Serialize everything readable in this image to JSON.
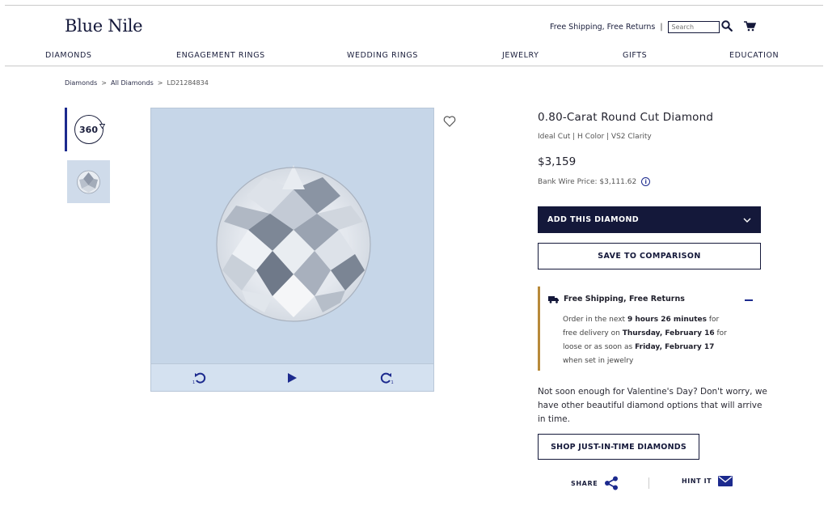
{
  "header": {
    "logo": "Blue Nile",
    "shipping_text": "Free Shipping, Free Returns",
    "separator": "|",
    "search_placeholder": "Search"
  },
  "nav": {
    "items": [
      "DIAMONDS",
      "ENGAGEMENT RINGS",
      "WEDDING RINGS",
      "JEWELRY",
      "GIFTS",
      "EDUCATION"
    ]
  },
  "breadcrumb": {
    "items": [
      "Diamonds",
      "All Diamonds",
      "LD21284834"
    ],
    "separator": ">"
  },
  "gallery": {
    "thumb_360_label": "360"
  },
  "product": {
    "title": "0.80-Carat Round Cut Diamond",
    "subtitle": "Ideal Cut | H Color | VS2 Clarity",
    "price": "$3,159",
    "bank_wire": "Bank Wire Price: $3,111.62",
    "info_icon": "i"
  },
  "actions": {
    "add_label": "ADD THIS DIAMOND",
    "compare_label": "SAVE TO COMPARISON"
  },
  "shipping": {
    "heading": "Free Shipping, Free Returns",
    "line1_pre": "Order in the next ",
    "line1_bold": "9 hours 26 minutes",
    "line1_post": " for",
    "line2_pre": "free delivery on ",
    "line2_bold": "Thursday, February 16",
    "line2_post": " for",
    "line3_pre": "loose or as soon as ",
    "line3_bold": "Friday, February 17",
    "line4": "when set in jewelry"
  },
  "promo": {
    "text": "Not soon enough for Valentine's Day? Don't worry, we have other beautiful diamond options that will arrive in time.",
    "button_label": "SHOP JUST-IN-TIME DIAMONDS"
  },
  "social": {
    "share_label": "SHARE",
    "hint_label": "HINT IT"
  },
  "colors": {
    "navy": "#14183a",
    "accent_blue": "#1c2a8e",
    "gold": "#b88a3a",
    "viewer_bg": "#c6d6e8"
  }
}
